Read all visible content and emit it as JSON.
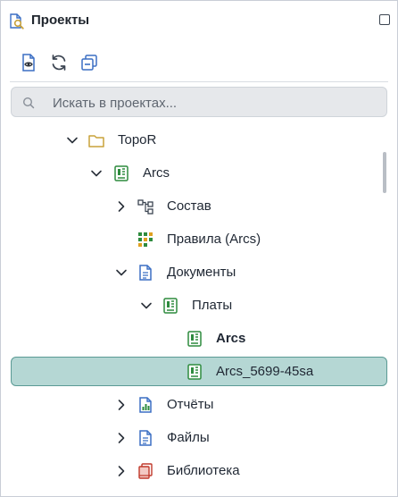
{
  "panel": {
    "title": "Проекты"
  },
  "toolbar": {
    "buttons": [
      {
        "icon": "document-eye-icon"
      },
      {
        "icon": "refresh-icon"
      },
      {
        "icon": "collapse-all-icon"
      }
    ]
  },
  "search": {
    "placeholder": "Искать в проектах..."
  },
  "tree": {
    "nodes": [
      {
        "label": "TopoR",
        "depth": 0,
        "expanded": true,
        "icon": "folder-icon"
      },
      {
        "label": "Arcs",
        "depth": 1,
        "expanded": true,
        "icon": "board-project-icon"
      },
      {
        "label": "Состав",
        "depth": 2,
        "expanded": false,
        "icon": "hierarchy-icon"
      },
      {
        "label": "Правила (Arcs)",
        "depth": 2,
        "expanded": null,
        "icon": "rules-grid-icon"
      },
      {
        "label": "Документы",
        "depth": 2,
        "expanded": true,
        "icon": "documents-icon"
      },
      {
        "label": "Платы",
        "depth": 3,
        "expanded": true,
        "icon": "board-icon"
      },
      {
        "label": "Arcs",
        "depth": 4,
        "expanded": null,
        "icon": "board-icon",
        "bold": true
      },
      {
        "label": "Arcs_5699-45sa",
        "depth": 4,
        "expanded": null,
        "icon": "board-icon",
        "selected": true
      },
      {
        "label": "Отчёты",
        "depth": 2,
        "expanded": false,
        "icon": "report-chart-icon"
      },
      {
        "label": "Файлы",
        "depth": 2,
        "expanded": false,
        "icon": "file-icon"
      },
      {
        "label": "Библиотека",
        "depth": 2,
        "expanded": false,
        "icon": "library-books-icon"
      }
    ]
  },
  "colors": {
    "accent_green": "#2e8b3e",
    "accent_blue": "#3b6fc4",
    "folder": "#c9a23a",
    "selection_bg": "#b5d7d4",
    "selection_border": "#5a9a94"
  }
}
